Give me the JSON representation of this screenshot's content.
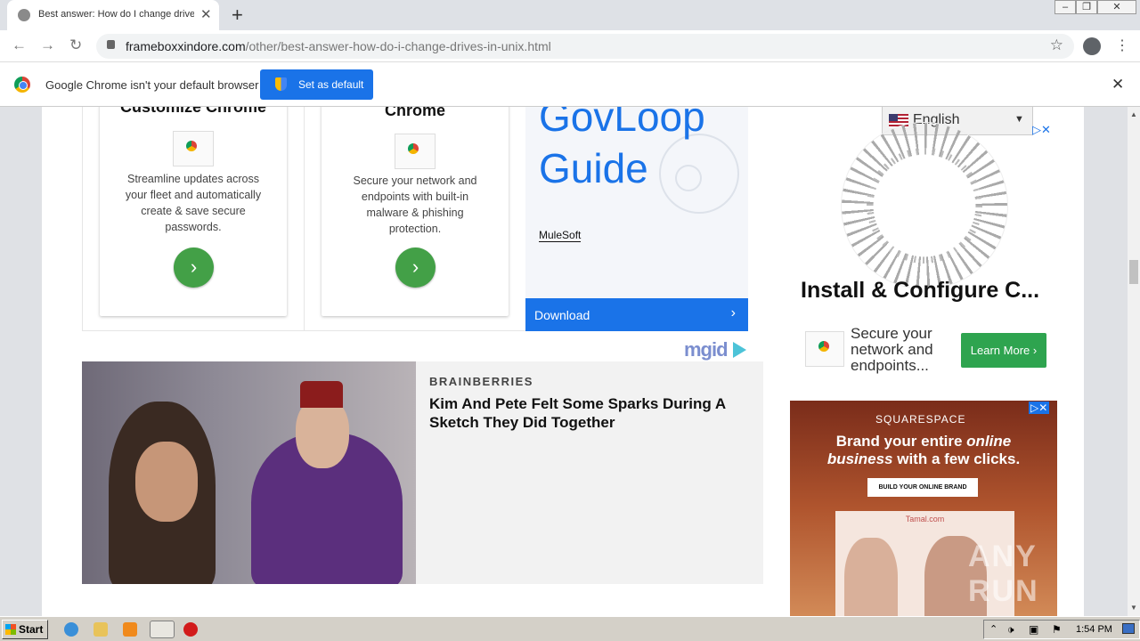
{
  "browser": {
    "tab_title": "Best answer: How do I change drive",
    "url_domain": "frameboxxindore.com",
    "url_path": "/other/best-answer-how-do-i-change-drives-in-unix.html",
    "infobar_message": "Google Chrome isn't your default browser",
    "set_default_label": "Set as default"
  },
  "page": {
    "card1": {
      "title": "Customize Chrome",
      "text": "Streamline updates across your fleet and automatically create & save secure passwords."
    },
    "card2": {
      "title": "Chrome",
      "text": "Secure your network and endpoints with built-in malware & phishing protection."
    },
    "govloop": {
      "headline": "GovLoop Guide",
      "sponsor": "MuleSoft",
      "download_label": "Download"
    },
    "mgid_logo": "mgid",
    "article": {
      "source": "BRAINBERRIES",
      "headline": "Kim And Pete Felt Some Sparks During A Sketch They Did Together"
    },
    "language": {
      "selected": "English"
    },
    "ad_right": {
      "title": "Install & Configure C...",
      "text": "Secure your network and endpoints...",
      "cta": "Learn More"
    },
    "squarespace": {
      "brand": "SQUARESPACE",
      "headline_part1": "Brand your entire ",
      "headline_em1": "online",
      "headline_part2": "business",
      "headline_part3": " with a few clicks.",
      "cta": "BUILD YOUR ONLINE BRAND",
      "mock_title": "Tamal.com"
    },
    "watermark": "ANY RUN"
  },
  "taskbar": {
    "start_label": "Start",
    "clock": "1:54 PM"
  },
  "colors": {
    "accent": "#1a73e8",
    "green": "#43a047",
    "mgid": "#7b8ecf"
  }
}
